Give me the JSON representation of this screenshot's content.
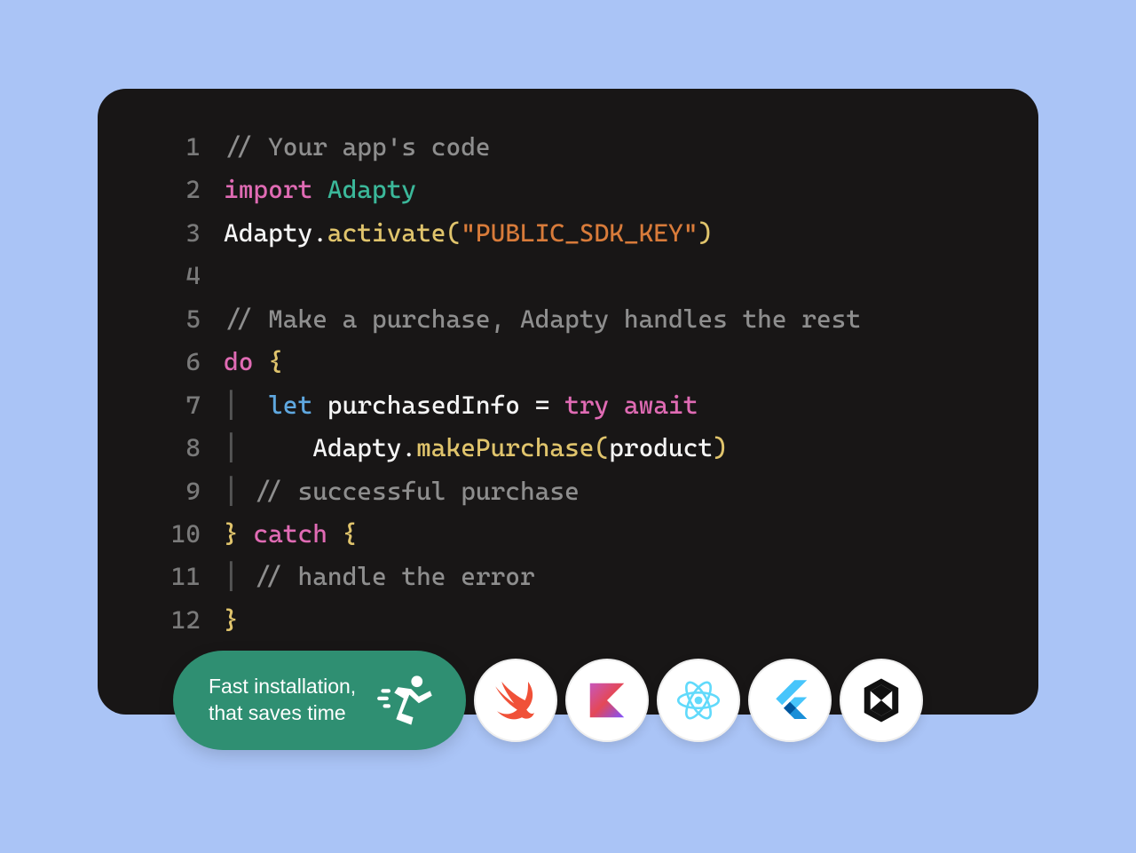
{
  "code": {
    "lines": [
      {
        "num": "1",
        "segments": [
          {
            "cls": "comment",
            "t": "// Your app's code"
          }
        ]
      },
      {
        "num": "2",
        "segments": [
          {
            "cls": "keyword-import",
            "t": "import"
          },
          {
            "cls": "plain",
            "t": " "
          },
          {
            "cls": "type-name",
            "t": "Adapty"
          }
        ]
      },
      {
        "num": "3",
        "segments": [
          {
            "cls": "plain",
            "t": "Adapty"
          },
          {
            "cls": "plain",
            "t": "."
          },
          {
            "cls": "method",
            "t": "activate"
          },
          {
            "cls": "paren",
            "t": "("
          },
          {
            "cls": "string",
            "t": "\"PUBLIC_SDK_KEY\""
          },
          {
            "cls": "paren",
            "t": ")"
          }
        ]
      },
      {
        "num": "4",
        "segments": []
      },
      {
        "num": "5",
        "segments": [
          {
            "cls": "comment",
            "t": "// Make a purchase, Adapty handles the rest"
          }
        ]
      },
      {
        "num": "6",
        "segments": [
          {
            "cls": "keyword-do",
            "t": "do"
          },
          {
            "cls": "plain",
            "t": " "
          },
          {
            "cls": "brace-yellow",
            "t": "{"
          }
        ]
      },
      {
        "num": "7",
        "segments": [
          {
            "cls": "indent-guide",
            "t": "│  "
          },
          {
            "cls": "keyword-let",
            "t": "let"
          },
          {
            "cls": "plain",
            "t": " purchasedInfo "
          },
          {
            "cls": "operator",
            "t": "="
          },
          {
            "cls": "plain",
            "t": " "
          },
          {
            "cls": "keyword-try",
            "t": "try"
          },
          {
            "cls": "plain",
            "t": " "
          },
          {
            "cls": "keyword-await",
            "t": "await"
          }
        ]
      },
      {
        "num": "8",
        "segments": [
          {
            "cls": "indent-guide",
            "t": "│     "
          },
          {
            "cls": "plain",
            "t": "Adapty"
          },
          {
            "cls": "plain",
            "t": "."
          },
          {
            "cls": "method",
            "t": "makePurchase"
          },
          {
            "cls": "paren",
            "t": "("
          },
          {
            "cls": "plain",
            "t": "product"
          },
          {
            "cls": "paren",
            "t": ")"
          }
        ]
      },
      {
        "num": "9",
        "segments": [
          {
            "cls": "indent-guide",
            "t": "│"
          },
          {
            "cls": "comment",
            "t": " // successful purchase"
          }
        ]
      },
      {
        "num": "10",
        "segments": [
          {
            "cls": "brace-yellow",
            "t": "}"
          },
          {
            "cls": "plain",
            "t": " "
          },
          {
            "cls": "keyword-catch",
            "t": "catch"
          },
          {
            "cls": "plain",
            "t": " "
          },
          {
            "cls": "brace-yellow",
            "t": "{"
          }
        ]
      },
      {
        "num": "11",
        "segments": [
          {
            "cls": "indent-guide",
            "t": "│"
          },
          {
            "cls": "comment",
            "t": " // handle the error"
          }
        ]
      },
      {
        "num": "12",
        "segments": [
          {
            "cls": "brace-yellow",
            "t": "}"
          }
        ]
      }
    ]
  },
  "badge": {
    "line1": "Fast installation,",
    "line2": "that saves time"
  },
  "sdk_icons": [
    "swift",
    "kotlin",
    "react",
    "flutter",
    "unity"
  ]
}
